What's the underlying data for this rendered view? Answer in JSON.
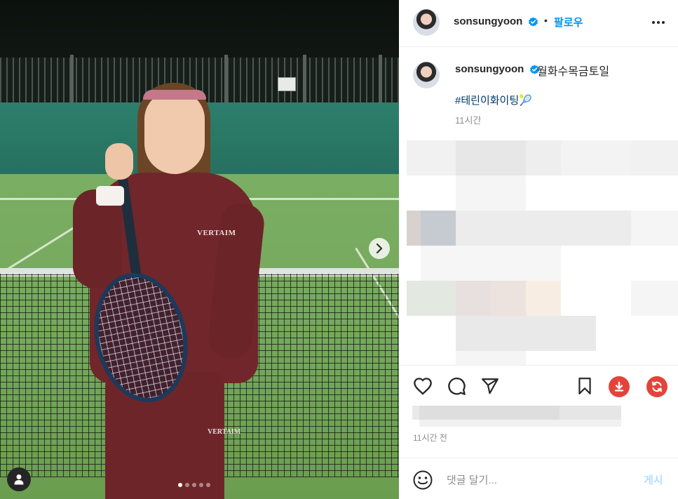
{
  "post": {
    "carousel_total": 5,
    "carousel_active_index": 0
  },
  "header": {
    "username": "sonsungyoon",
    "separator": "•",
    "follow_label": "팔로우"
  },
  "caption": {
    "username": "sonsungyoon",
    "text": "월화수목금토일",
    "hashtag": "#테린이화이팅",
    "hashtag_emoji": "🎾",
    "time": "11시간"
  },
  "meta": {
    "time_ago": "11시간 전"
  },
  "comment": {
    "placeholder": "댓글 달기...",
    "post_label": "게시"
  },
  "colors": {
    "accent": "#0095f6",
    "hashtag": "#00376b",
    "download_button": "#e4433b",
    "refresh_button": "#e4433b"
  },
  "icons": {
    "like": "heart-icon",
    "comment": "comment-icon",
    "share": "paper-plane-icon",
    "save": "bookmark-icon",
    "download": "download-icon",
    "refresh": "refresh-icon",
    "more": "more-options-icon",
    "verified": "verified-badge-icon",
    "emoji": "emoji-icon",
    "next": "chevron-right-icon",
    "tag_user": "user-tag-icon"
  }
}
